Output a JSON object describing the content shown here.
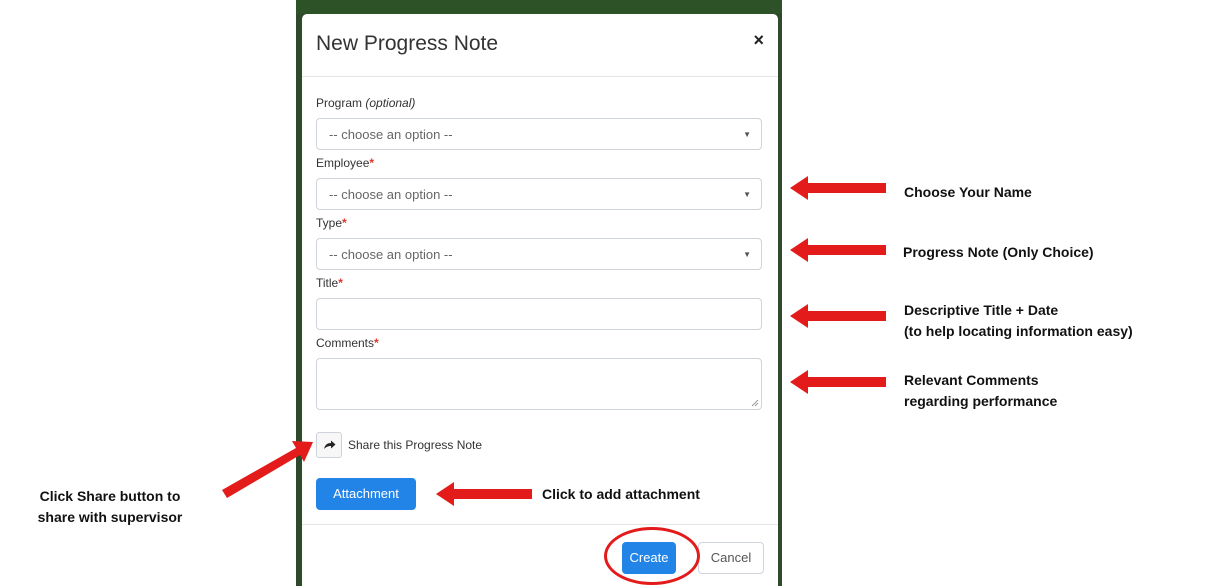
{
  "modal": {
    "title": "New Progress Note",
    "close_label": "×"
  },
  "form": {
    "program_label": "Program",
    "program_optional": "(optional)",
    "program_value": "-- choose an option --",
    "employee_label": "Employee",
    "employee_value": "-- choose an option --",
    "type_label": "Type",
    "type_value": "-- choose an option --",
    "title_label": "Title",
    "title_value": "",
    "comments_label": "Comments",
    "comments_value": "",
    "required_mark": "*",
    "share_label": "Share this Progress Note",
    "attachment_label": "Attachment",
    "create_label": "Create",
    "cancel_label": "Cancel"
  },
  "annotations": {
    "choose_name": "Choose Your Name",
    "progress_note": "Progress Note (Only Choice)",
    "title_line1": "Descriptive Title + Date",
    "title_line2": "(to help locating information easy)",
    "comments_line1": "Relevant Comments",
    "comments_line2": "regarding performance",
    "attachment": "Click to add attachment",
    "share_line1": "Click Share button to",
    "share_line2": "share with supervisor"
  },
  "colors": {
    "arrow": "#e31b1b",
    "primary_button": "#2384e8",
    "backdrop": "#2f4a2a"
  },
  "icons": {
    "share": "share-arrow-icon",
    "select_caret": "caret-down-icon",
    "close": "close-icon"
  }
}
